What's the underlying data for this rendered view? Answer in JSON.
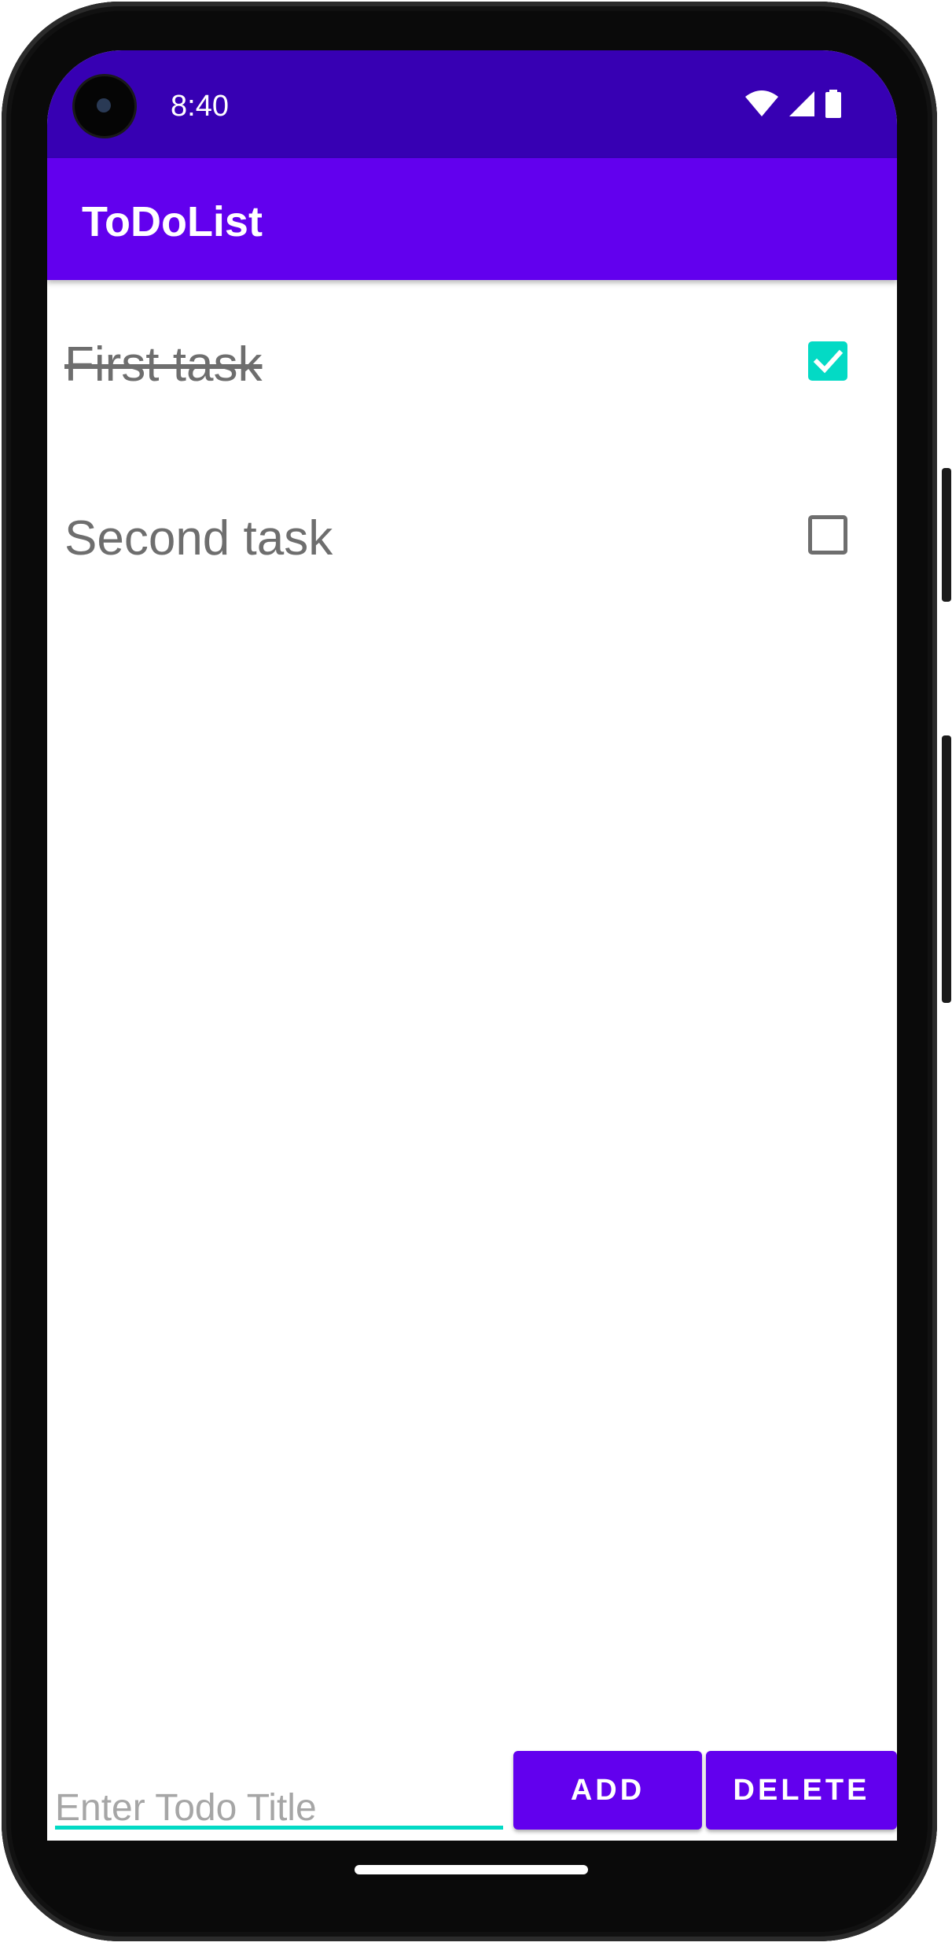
{
  "status_bar": {
    "time": "8:40",
    "icons": [
      "wifi-icon",
      "cellular-signal-icon",
      "battery-icon"
    ],
    "color": "#3700b3"
  },
  "app_bar": {
    "title": "ToDoList",
    "color": "#6200ee"
  },
  "tasks": [
    {
      "title": "First task",
      "checked": true
    },
    {
      "title": "Second task",
      "checked": false
    }
  ],
  "input": {
    "placeholder": "Enter Todo Title",
    "value": ""
  },
  "buttons": {
    "add_label": "ADD",
    "delete_label": "DELETE"
  },
  "colors": {
    "accent": "#03dac5",
    "primary": "#6200ee",
    "primary_dark": "#3700b3"
  }
}
